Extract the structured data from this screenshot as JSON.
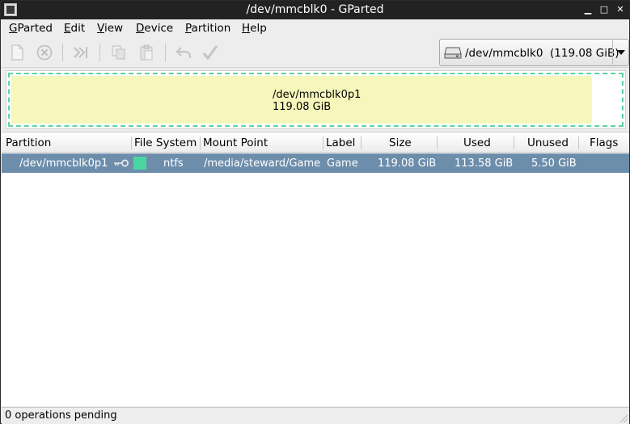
{
  "window": {
    "title": "/dev/mmcblk0 - GParted",
    "buttons": {
      "minimize": "▁",
      "maximize": "□",
      "close": "✕"
    }
  },
  "menubar": {
    "items": [
      {
        "mnemonic": "G",
        "rest": "Parted"
      },
      {
        "mnemonic": "E",
        "rest": "dit"
      },
      {
        "mnemonic": "V",
        "rest": "iew"
      },
      {
        "mnemonic": "D",
        "rest": "evice"
      },
      {
        "mnemonic": "P",
        "rest": "artition"
      },
      {
        "mnemonic": "H",
        "rest": "elp"
      }
    ]
  },
  "toolbar": {
    "icons": [
      "new-icon",
      "delete-icon",
      "resize-move-icon",
      "copy-icon",
      "paste-icon",
      "undo-icon",
      "apply-icon"
    ]
  },
  "device_selector": {
    "device": "/dev/mmcblk0",
    "size": "(119.08 GiB)"
  },
  "partition_graphic": {
    "name": "/dev/mmcblk0p1",
    "size": "119.08 GiB",
    "used_fraction": 0.954,
    "fill_color": "#f7f6bb",
    "border_color": "#5fd3a0"
  },
  "table": {
    "headers": [
      "Partition",
      "File System",
      "Mount Point",
      "Label",
      "Size",
      "Used",
      "Unused",
      "Flags"
    ],
    "rows": [
      {
        "partition": "/dev/mmcblk0p1",
        "mounted_icon": "key-icon",
        "fs_color": "#4ad6a1",
        "file_system": "ntfs",
        "mount_point": "/media/steward/Game",
        "label": "Game",
        "size": "119.08 GiB",
        "used": "113.58 GiB",
        "unused": "5.50 GiB",
        "flags": ""
      }
    ],
    "selected_color": "#6d8eab"
  },
  "statusbar": {
    "text": "0 operations pending"
  }
}
